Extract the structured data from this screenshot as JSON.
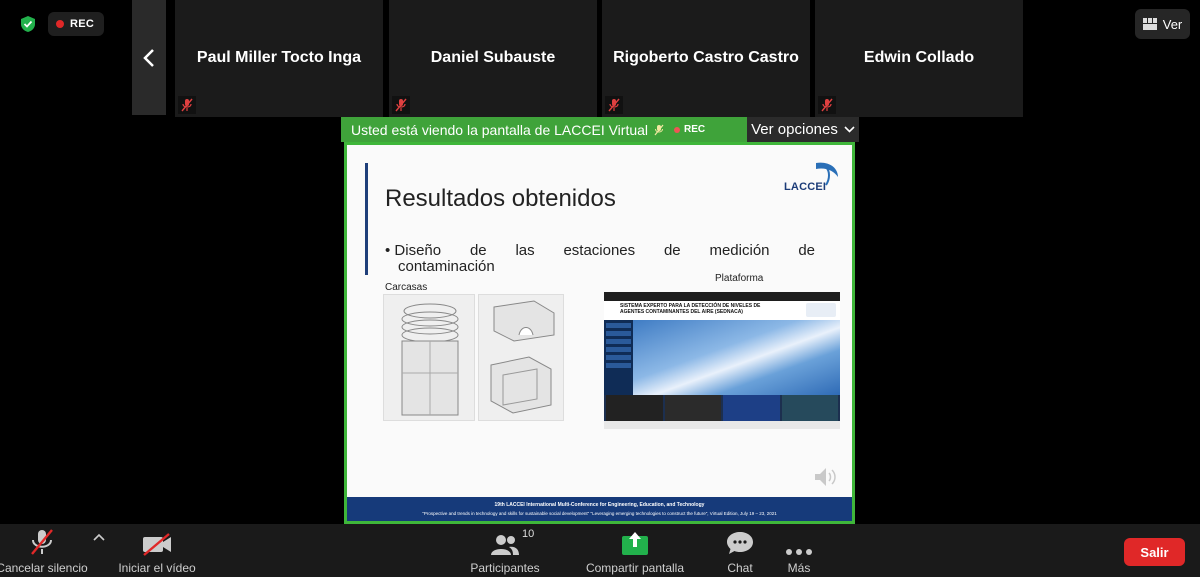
{
  "recording": {
    "label": "REC"
  },
  "participants_strip": [
    {
      "name": "Paul Miller Tocto Inga",
      "muted": true
    },
    {
      "name": "Daniel Subauste",
      "muted": true
    },
    {
      "name": "Rigoberto Castro Castro",
      "muted": true
    },
    {
      "name": "Edwin Collado",
      "muted": true
    }
  ],
  "view_button": {
    "label": "Ver"
  },
  "share_banner": {
    "text": "Usted está viendo la pantalla de LACCEI Virtual",
    "rec_label": "REC",
    "options_label": "Ver opciones"
  },
  "slide": {
    "title": "Resultados obtenidos",
    "logo_text": "LACCEI",
    "bullet_words": [
      "Diseño",
      "de",
      "las",
      "estaciones",
      "de",
      "medición",
      "de"
    ],
    "bullet_line2": "contaminación",
    "caption_left": "Carcasas",
    "caption_right": "Plataforma",
    "platform_header": "SISTEMA EXPERTO PARA LA DETECCIÓN DE NIVELES DE AGENTES CONTAMINANTES DEL AIRE (SEDNACA)",
    "footer_line1": "19th LACCEI International Multi-Conference for Engineering, Education, and Technology",
    "footer_line2": "\"Prospective and trends in technology and skills for sustainable social development\" \"Leveraging emerging technologies to construct the future\", Virtual Edition, July 19 – 23, 2021"
  },
  "toolbar": {
    "mute_label": "Cancelar silencio",
    "video_label": "Iniciar el vídeo",
    "participants_label": "Participantes",
    "participants_count": "10",
    "share_label": "Compartir pantalla",
    "chat_label": "Chat",
    "more_label": "Más",
    "leave_label": "Salir"
  },
  "colors": {
    "share_green": "#3fa33a",
    "leave_red": "#e02828",
    "slide_footer_blue": "#163a7a"
  }
}
